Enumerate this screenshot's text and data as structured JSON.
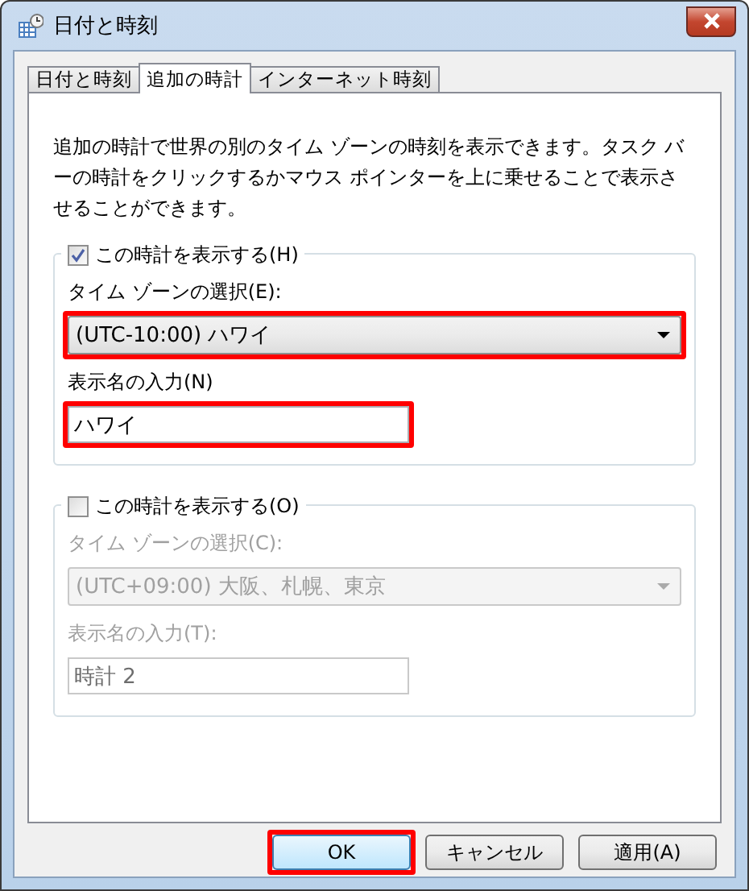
{
  "window": {
    "title": "日付と時刻"
  },
  "tabs": [
    {
      "label": "日付と時刻",
      "selected": false
    },
    {
      "label": "追加の時計",
      "selected": true
    },
    {
      "label": "インターネット時刻",
      "selected": false
    }
  ],
  "description": "追加の時計で世界の別のタイム ゾーンの時刻を表示できます。タスク バーの時計をクリックするかマウス ポインターを上に乗せることで表示させることができます。",
  "clocks": [
    {
      "show_label": "この時計を表示する(H)",
      "checked": true,
      "disabled": false,
      "timezone_label": "タイム ゾーンの選択(E):",
      "timezone": "(UTC-10:00) ハワイ",
      "timezone_highlighted": true,
      "name_label": "表示名の入力(N)",
      "name": "ハワイ",
      "name_highlighted": true
    },
    {
      "show_label": "この時計を表示する(O)",
      "checked": false,
      "disabled": true,
      "timezone_label": "タイム ゾーンの選択(C):",
      "timezone": "(UTC+09:00) 大阪、札幌、東京",
      "timezone_highlighted": false,
      "name_label": "表示名の入力(T):",
      "name": "時計 2",
      "name_highlighted": false
    }
  ],
  "buttons": [
    {
      "label": "OK",
      "highlighted": true,
      "default": true
    },
    {
      "label": "キャンセル",
      "highlighted": false,
      "default": false
    },
    {
      "label": "適用(A)",
      "highlighted": false,
      "default": false
    }
  ]
}
